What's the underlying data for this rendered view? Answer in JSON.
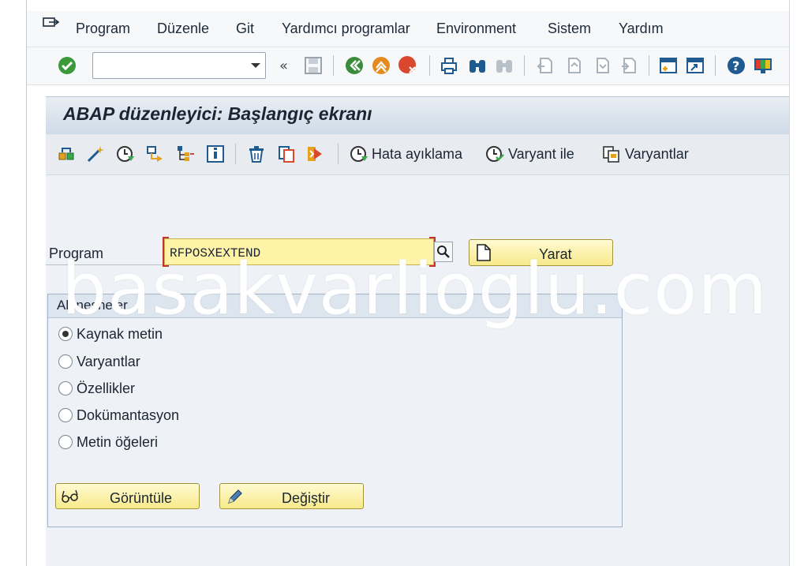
{
  "menu": {
    "items": [
      "Program",
      "Düzenle",
      "Git",
      "Yardımcı programlar",
      "Environment",
      "Sistem",
      "Yardım"
    ]
  },
  "toolbar": {
    "command_value": "",
    "icons": [
      "enter-check-icon",
      "save-icon",
      "back-icon",
      "exit-icon",
      "cancel-icon",
      "print-icon",
      "find-icon",
      "find-next-icon",
      "first-page-icon",
      "previous-page-icon",
      "next-page-icon",
      "last-page-icon",
      "new-session-icon",
      "shortcut-icon",
      "help-icon",
      "customize-layout-icon"
    ]
  },
  "screen": {
    "title": "ABAP düzenleyici: Başlangıç ekranı"
  },
  "app_toolbar": {
    "debug_label": "Hata ayıklama",
    "variant_with_label": "Varyant ile",
    "variants_label": "Varyantlar"
  },
  "form": {
    "program_label": "Program",
    "program_value": "RFPOSXEXTEND",
    "create_label": "Yarat"
  },
  "subobjects": {
    "title": "Alt nesneler",
    "options": [
      {
        "label": "Kaynak metin",
        "selected": true
      },
      {
        "label": "Varyantlar",
        "selected": false
      },
      {
        "label": "Özellikler",
        "selected": false
      },
      {
        "label": "Dokümantasyon",
        "selected": false
      },
      {
        "label": "Metin öğeleri",
        "selected": false
      }
    ],
    "display_label": "Görüntüle",
    "change_label": "Değiştir"
  },
  "watermark": "basakvarlioglu.com",
  "colors": {
    "title_bar": "#cfdbe7",
    "required_input": "#fff3a8",
    "button_yellow": "#f8e98a",
    "ok_green": "#3a9a3a",
    "cancel_red": "#d9482c"
  }
}
